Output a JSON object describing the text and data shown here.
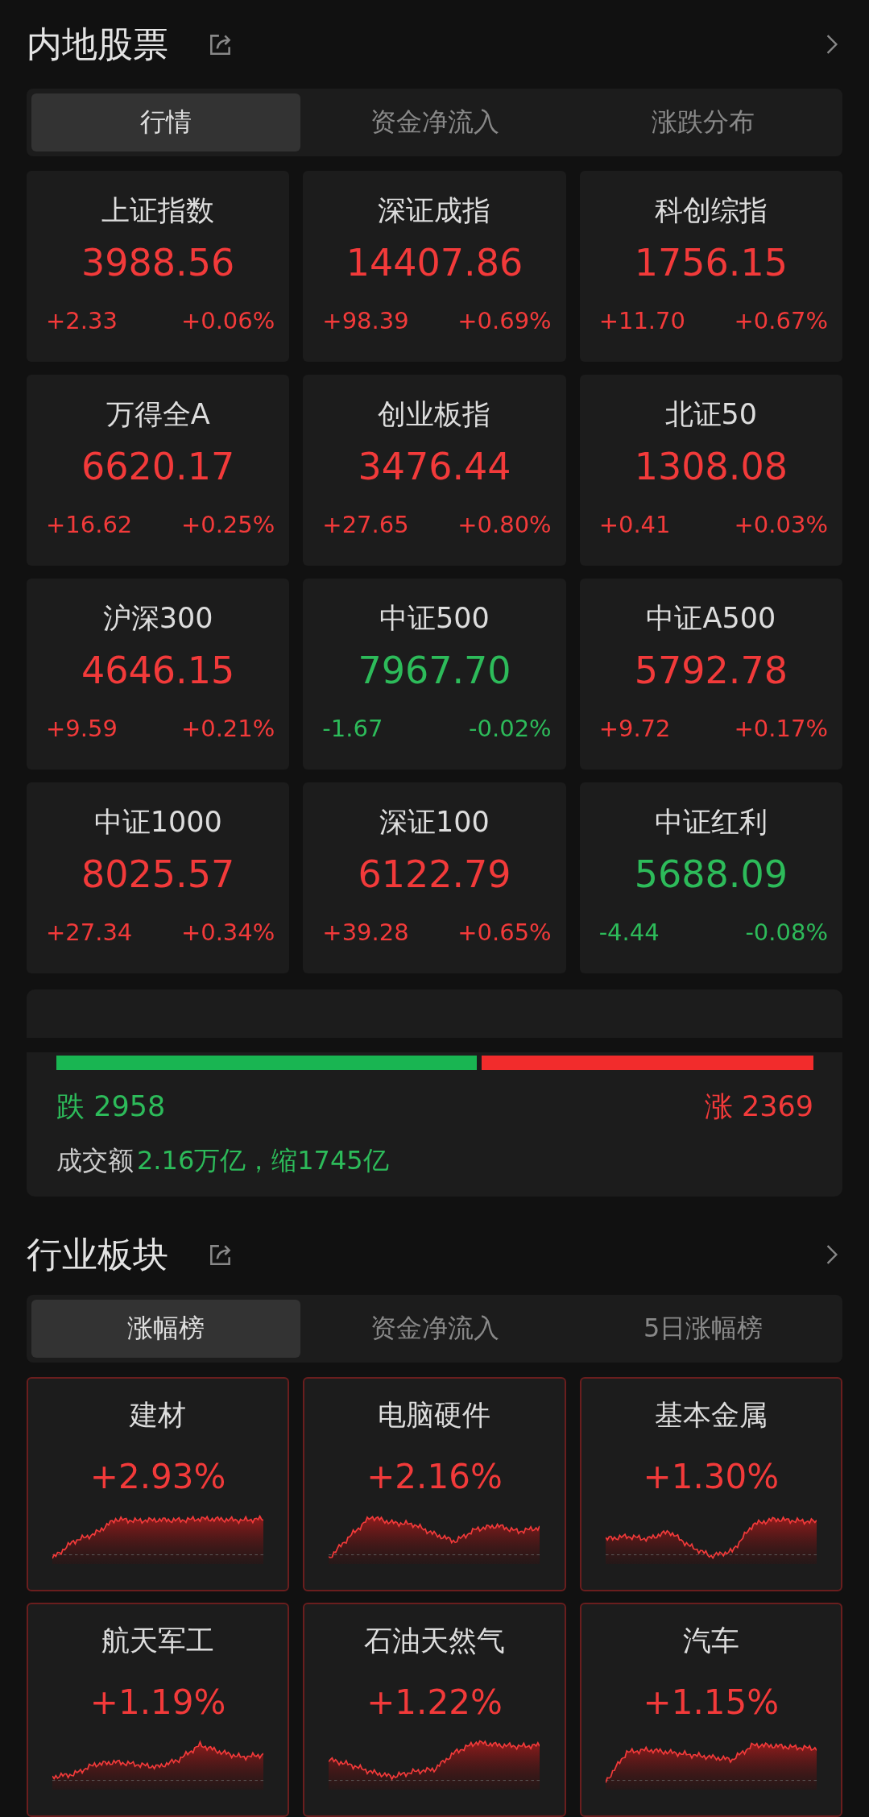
{
  "market": {
    "title": "内地股票",
    "tabs": [
      {
        "label": "行情",
        "selected": true
      },
      {
        "label": "资金净流入",
        "selected": false
      },
      {
        "label": "涨跌分布",
        "selected": false
      }
    ],
    "indices": [
      {
        "name": "上证指数",
        "value": "3988.56",
        "change": "+2.33",
        "percent": "+0.06%",
        "kind": "up"
      },
      {
        "name": "深证成指",
        "value": "14407.86",
        "change": "+98.39",
        "percent": "+0.69%",
        "kind": "up"
      },
      {
        "name": "科创综指",
        "value": "1756.15",
        "change": "+11.70",
        "percent": "+0.67%",
        "kind": "up"
      },
      {
        "name": "万得全A",
        "value": "6620.17",
        "change": "+16.62",
        "percent": "+0.25%",
        "kind": "up"
      },
      {
        "name": "创业板指",
        "value": "3476.44",
        "change": "+27.65",
        "percent": "+0.80%",
        "kind": "up"
      },
      {
        "name": "北证50",
        "value": "1308.08",
        "change": "+0.41",
        "percent": "+0.03%",
        "kind": "up"
      },
      {
        "name": "沪深300",
        "value": "4646.15",
        "change": "+9.59",
        "percent": "+0.21%",
        "kind": "up"
      },
      {
        "name": "中证500",
        "value": "7967.70",
        "change": "-1.67",
        "percent": "-0.02%",
        "kind": "down"
      },
      {
        "name": "中证A500",
        "value": "5792.78",
        "change": "+9.72",
        "percent": "+0.17%",
        "kind": "up"
      },
      {
        "name": "中证1000",
        "value": "8025.57",
        "change": "+27.34",
        "percent": "+0.34%",
        "kind": "up"
      },
      {
        "name": "深证100",
        "value": "6122.79",
        "change": "+39.28",
        "percent": "+0.65%",
        "kind": "up"
      },
      {
        "name": "中证红利",
        "value": "5688.09",
        "change": "-4.44",
        "percent": "-0.08%",
        "kind": "down"
      }
    ],
    "breadth": {
      "level": 0.555,
      "down": "跌 2958",
      "up": "涨 2369",
      "turnover_label": "成交额",
      "turnover": "2.16万亿，缩1745亿"
    }
  },
  "sectors": {
    "title": "行业板块",
    "tabs": [
      {
        "label": "涨幅榜",
        "selected": true
      },
      {
        "label": "资金净流入",
        "selected": false
      },
      {
        "label": "5日涨幅榜",
        "selected": false
      }
    ],
    "items": [
      {
        "name": "建材",
        "percent": "+2.93%"
      },
      {
        "name": "电脑硬件",
        "percent": "+2.16%"
      },
      {
        "name": "基本金属",
        "percent": "+1.30%"
      },
      {
        "name": "航天军工",
        "percent": "+1.19%"
      },
      {
        "name": "石油天然气",
        "percent": "+1.22%"
      },
      {
        "name": "汽车",
        "percent": "+1.15%"
      }
    ]
  }
}
